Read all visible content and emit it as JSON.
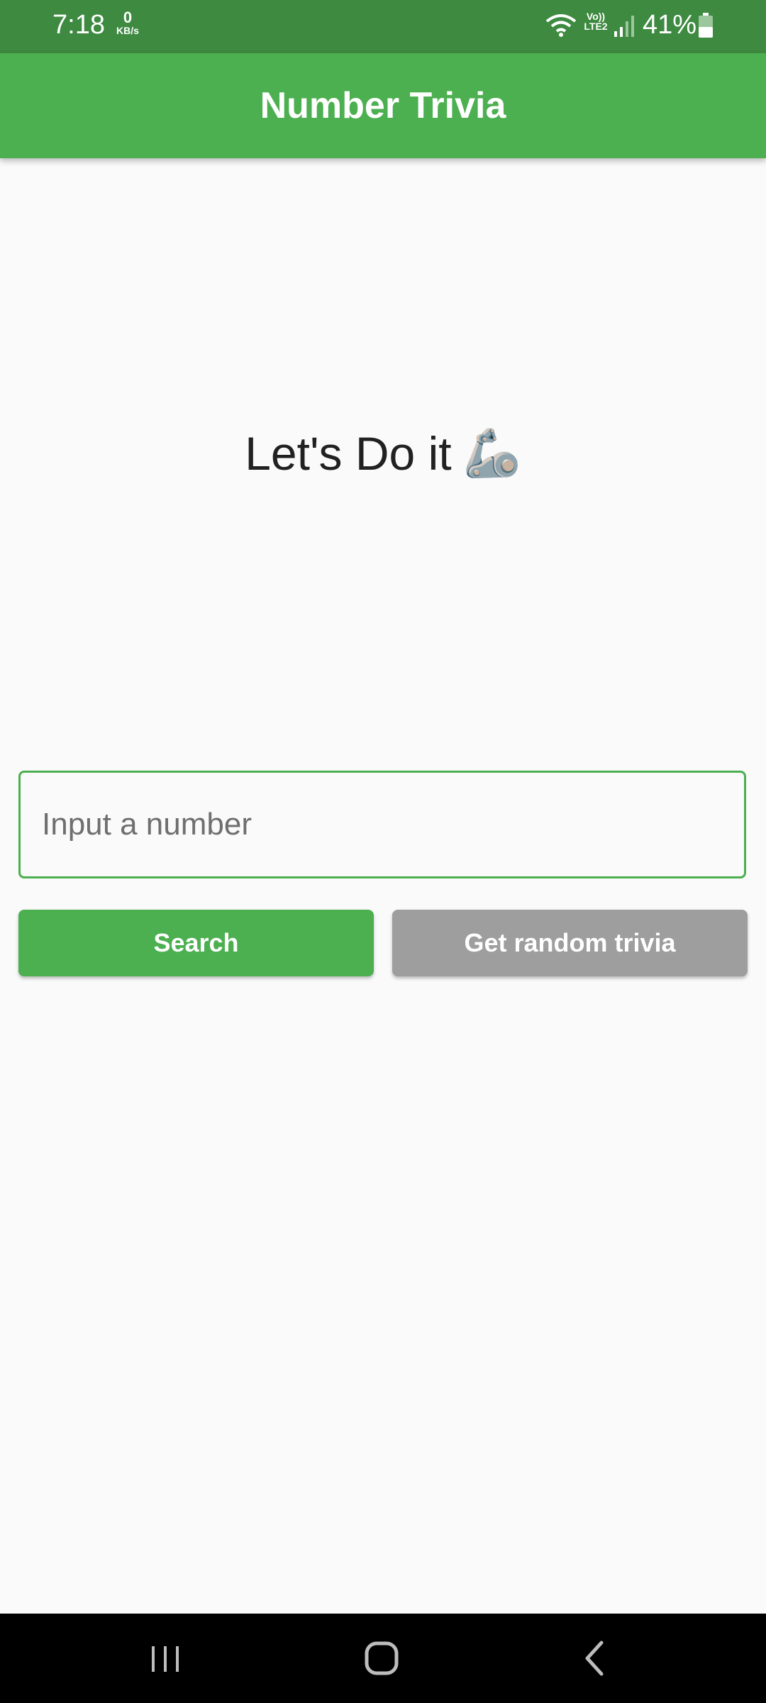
{
  "status_bar": {
    "time": "7:18",
    "net_speed_value": "0",
    "net_speed_unit": "KB/s",
    "network_label": "Vo)) LTE2",
    "battery_percent": "41%",
    "icons": [
      "wifi-icon",
      "signal-icon",
      "battery-icon"
    ]
  },
  "app_bar": {
    "title": "Number Trivia"
  },
  "main": {
    "message": "Let's Do it",
    "message_emoji": "🦾",
    "input": {
      "value": "",
      "placeholder": "Input a number"
    },
    "search_button_label": "Search",
    "random_button_label": "Get random trivia"
  },
  "nav_bar": {
    "icons": [
      "recents-icon",
      "home-icon",
      "back-icon"
    ]
  },
  "colors": {
    "primary": "#4caf50",
    "primary_dark": "#3d8a40",
    "disabled_button": "#9e9e9e",
    "background": "#fafafa"
  }
}
